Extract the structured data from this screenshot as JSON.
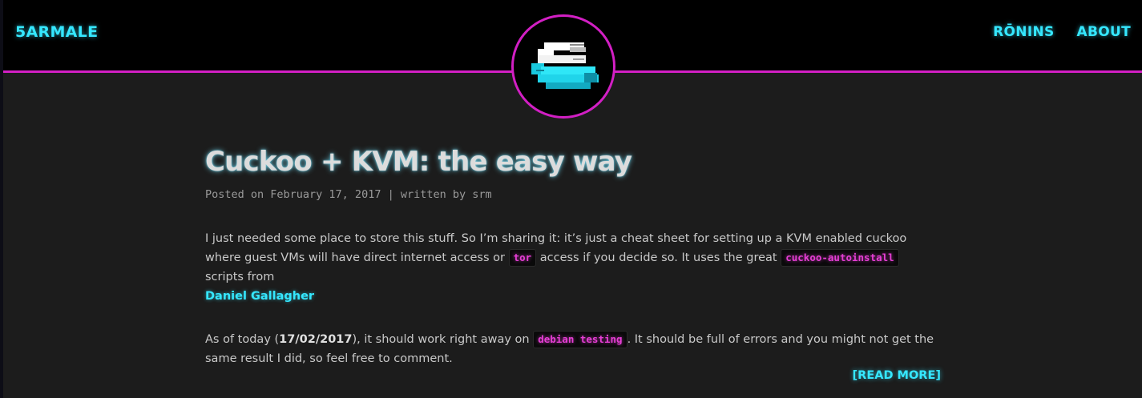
{
  "header": {
    "brand": "5ARMALE",
    "nav": [
      {
        "label": "RŌNINS"
      },
      {
        "label": "ABOUT"
      }
    ]
  },
  "logo": {
    "letter": "S",
    "icon": "pixel-s-logo-icon"
  },
  "post": {
    "title": "Cuckoo + KVM: the easy way",
    "meta": "Posted on February 17, 2017 | written by srm",
    "paragraph1": {
      "t1": "I just needed some place to store this stuff. So I’m sharing it: it’s just a cheat sheet for setting up a KVM enabled cuckoo where guest VMs will have direct internet access or ",
      "code1": "tor",
      "t2": " access if you decide so. It uses the great ",
      "code2": "cuckoo-autoinstall",
      "t3": " scripts from ",
      "link": "Daniel Gallagher"
    },
    "paragraph2": {
      "t1": "As of today (",
      "date": "17/02/2017",
      "t2": "), it should work right away on ",
      "code": "debian testing",
      "t3": ". It should be full of errors and you might not get the same result I did, so feel free to comment."
    },
    "read_more": "[READ MORE]"
  },
  "colors": {
    "accent_cyan": "#35e7ff",
    "accent_magenta": "#d21fc4",
    "background": "#1c1c1c",
    "topbar": "#000000"
  }
}
